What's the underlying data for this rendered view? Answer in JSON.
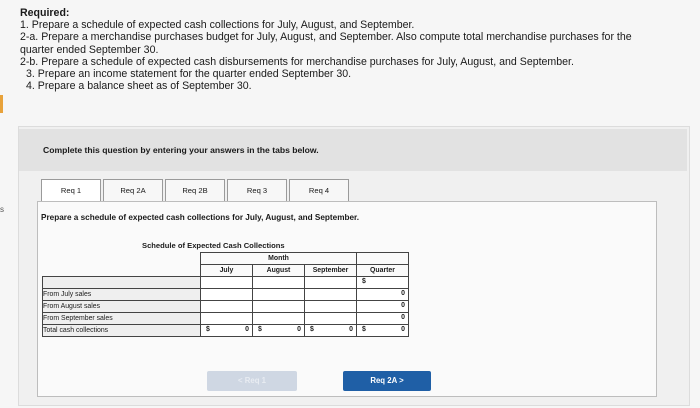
{
  "required": {
    "title": "Required:",
    "lines": [
      "1. Prepare a schedule of expected cash collections for July, August, and September.",
      "2-a. Prepare a merchandise purchases budget for July, August, and September. Also compute total merchandise purchases for the",
      "quarter ended September 30.",
      "2-b. Prepare a schedule of expected cash disbursements for merchandise purchases for July, August, and September.",
      "3. Prepare an income statement for the quarter ended September 30.",
      "4. Prepare a balance sheet as of September 30."
    ]
  },
  "left_mark": "s",
  "instruction": "Complete this question by entering your answers in the tabs below.",
  "tabs": [
    "Req 1",
    "Req 2A",
    "Req 2B",
    "Req 3",
    "Req 4"
  ],
  "prompt": "Prepare a schedule of expected cash collections for July, August, and September.",
  "schedule": {
    "title": "Schedule of Expected Cash Collections",
    "month_header": "Month",
    "columns": [
      "July",
      "August",
      "September",
      "Quarter"
    ],
    "rows": [
      {
        "label": "From July sales",
        "values": [
          "",
          "",
          "",
          "0"
        ],
        "currency": [
          "",
          "",
          "",
          "$"
        ]
      },
      {
        "label": "From August sales",
        "values": [
          "",
          "",
          "",
          "0"
        ],
        "currency": [
          "",
          "",
          "",
          ""
        ]
      },
      {
        "label": "From September sales",
        "values": [
          "",
          "",
          "",
          "0"
        ],
        "currency": [
          "",
          "",
          "",
          ""
        ]
      },
      {
        "label": "Total cash collections",
        "values": [
          "0",
          "0",
          "0",
          "0"
        ],
        "currency": [
          "$",
          "$",
          "$",
          "$"
        ]
      }
    ]
  },
  "nav": {
    "prev": "<  Req 1",
    "next": "Req 2A  >"
  }
}
